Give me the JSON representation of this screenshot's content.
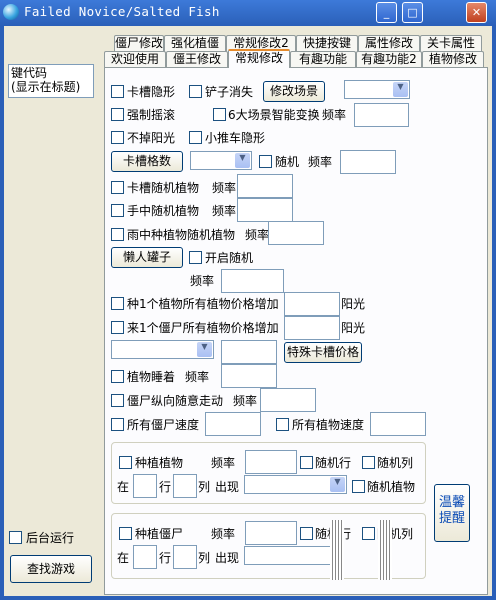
{
  "window": {
    "title": "Failed Novice/Salted Fish",
    "btn_min": "_",
    "btn_max": "□",
    "btn_close": "✕"
  },
  "left": {
    "hotkey_info": "键代码\n(显示在标题)",
    "bg_run": "后台运行",
    "find_game": "查找游戏"
  },
  "tabs_row1": [
    "僵尸修改",
    "强化植僵",
    "常规修改2",
    "快捷按键",
    "属性修改",
    "关卡属性"
  ],
  "tabs_row2": [
    "欢迎使用",
    "僵王修改",
    "常规修改",
    "有趣功能",
    "有趣功能2",
    "植物修改"
  ],
  "opts": {
    "card_slot_hide": "卡槽隐形",
    "shovel_gone": "铲子消失",
    "modify_scene": "修改场景",
    "force_shake": "强制摇滚",
    "six_scene": "6大场景智能变换",
    "freq": "频率",
    "no_sun_drop": "不掉阳光",
    "cart_hide": "小推车隐形",
    "slot_count": "卡槽格数",
    "random": "随机",
    "slot_rand_plant": "卡槽随机植物",
    "hand_rand_plant": "手中随机植物",
    "rain_rand_plant": "雨中种植物随机植物",
    "lazy_jar": "懒人罐子",
    "open_random": "开启随机",
    "plant_price_up": "种1个植物所有植物价格增加",
    "zombie_price_up": "来1个僵尸所有植物价格增加",
    "sun": "阳光",
    "special_price": "特殊卡槽价格",
    "plant_sleep": "植物睡着",
    "zombie_wander": "僵尸纵向随意走动",
    "all_zombie_speed": "所有僵尸速度",
    "all_plant_speed": "所有植物速度"
  },
  "group1": {
    "plant": "种植植物",
    "freq": "频率",
    "rand_row": "随机行",
    "rand_col": "随机列",
    "at": "在",
    "row": "行",
    "col": "列",
    "appear": "出现",
    "rand_plant": "随机植物"
  },
  "group2": {
    "plant": "种植僵尸",
    "freq": "频率",
    "rand_row": "随机行",
    "rand_col": "随机列",
    "at": "在",
    "row": "行",
    "col": "列",
    "appear": "出现"
  },
  "remind": "温馨\n提醒",
  "dropdown_arrow": "▼"
}
